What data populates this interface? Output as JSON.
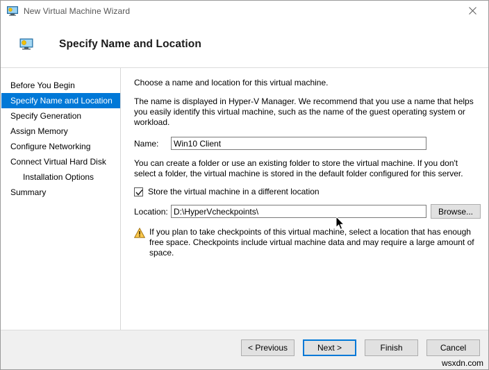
{
  "window": {
    "title": "New Virtual Machine Wizard",
    "title_icon": "vm-monitor-icon",
    "close_icon": "close-icon"
  },
  "header": {
    "icon": "vm-monitor-icon",
    "title": "Specify Name and Location"
  },
  "sidebar": {
    "items": [
      {
        "label": "Before You Begin",
        "selected": false,
        "indent": false
      },
      {
        "label": "Specify Name and Location",
        "selected": true,
        "indent": false
      },
      {
        "label": "Specify Generation",
        "selected": false,
        "indent": false
      },
      {
        "label": "Assign Memory",
        "selected": false,
        "indent": false
      },
      {
        "label": "Configure Networking",
        "selected": false,
        "indent": false
      },
      {
        "label": "Connect Virtual Hard Disk",
        "selected": false,
        "indent": false
      },
      {
        "label": "Installation Options",
        "selected": false,
        "indent": true
      },
      {
        "label": "Summary",
        "selected": false,
        "indent": false
      }
    ]
  },
  "content": {
    "intro": "Choose a name and location for this virtual machine.",
    "description": "The name is displayed in Hyper-V Manager. We recommend that you use a name that helps you easily identify this virtual machine, such as the name of the guest operating system or workload.",
    "name_label": "Name:",
    "name_value": "Win10 Client",
    "folder_text": "You can create a folder or use an existing folder to store the virtual machine. If you don't select a folder, the virtual machine is stored in the default folder configured for this server.",
    "checkbox_label": "Store the virtual machine in a different location",
    "checkbox_checked": true,
    "location_label": "Location:",
    "location_value": "D:\\HyperVcheckpoints\\",
    "browse_label": "Browse...",
    "warning_icon": "warning-triangle-icon",
    "warning_text": "If you plan to take checkpoints of this virtual machine, select a location that has enough free space. Checkpoints include virtual machine data and may require a large amount of space."
  },
  "footer": {
    "previous_label": "< Previous",
    "next_label": "Next >",
    "finish_label": "Finish",
    "cancel_label": "Cancel"
  },
  "watermark": "wsxdn.com",
  "colors": {
    "accent": "#0078d7",
    "button_face": "#e1e1e1",
    "footer_bg": "#f0f0f0",
    "warning": "#e8a317"
  }
}
